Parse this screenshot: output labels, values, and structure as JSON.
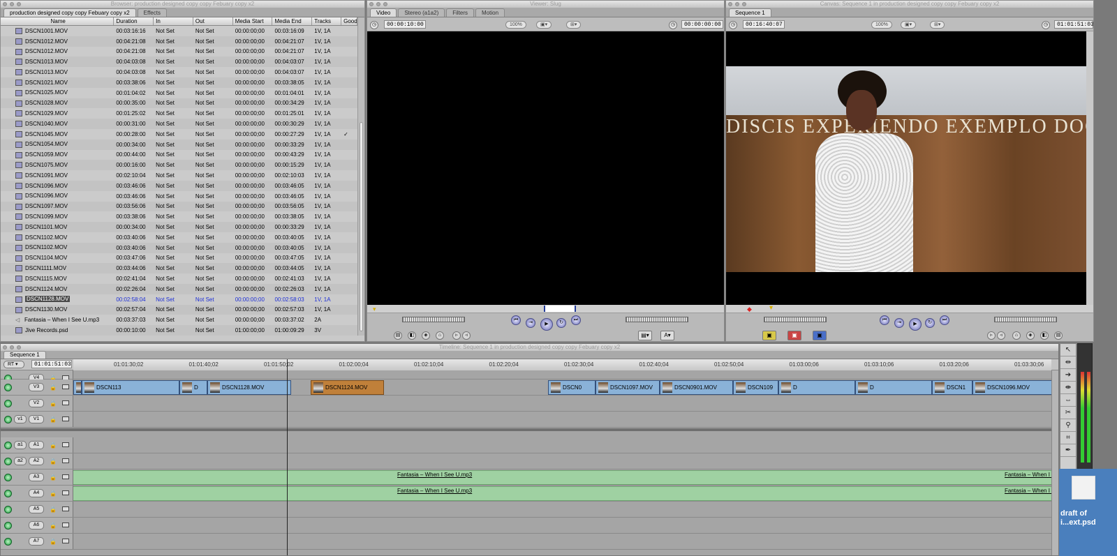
{
  "browser": {
    "title": "Browser: production designed copy copy Febuary copy x2",
    "tabs": [
      "production designed copy copy Febuary copy x2",
      "Effects"
    ],
    "columns": [
      "Name",
      "Duration",
      "In",
      "Out",
      "Media Start",
      "Media End",
      "Tracks",
      "Good"
    ],
    "rows": [
      {
        "name": "DSCN1001.MOV",
        "dur": "00:03:16:16",
        "in": "Not Set",
        "out": "Not Set",
        "ms": "00:00:00;00",
        "me": "00:03:16:09",
        "tr": "1V, 1A",
        "good": ""
      },
      {
        "name": "DSCN1012.MOV",
        "dur": "00:04:21:08",
        "in": "Not Set",
        "out": "Not Set",
        "ms": "00:00:00;00",
        "me": "00:04:21:07",
        "tr": "1V, 1A",
        "good": ""
      },
      {
        "name": "DSCN1012.MOV",
        "dur": "00:04:21:08",
        "in": "Not Set",
        "out": "Not Set",
        "ms": "00:00:00;00",
        "me": "00:04:21:07",
        "tr": "1V, 1A",
        "good": ""
      },
      {
        "name": "DSCN1013.MOV",
        "dur": "00:04:03:08",
        "in": "Not Set",
        "out": "Not Set",
        "ms": "00:00:00;00",
        "me": "00:04:03:07",
        "tr": "1V, 1A",
        "good": ""
      },
      {
        "name": "DSCN1013.MOV",
        "dur": "00:04:03:08",
        "in": "Not Set",
        "out": "Not Set",
        "ms": "00:00:00;00",
        "me": "00:04:03:07",
        "tr": "1V, 1A",
        "good": ""
      },
      {
        "name": "DSCN1021.MOV",
        "dur": "00:03:38:06",
        "in": "Not Set",
        "out": "Not Set",
        "ms": "00:00:00;00",
        "me": "00:03:38:05",
        "tr": "1V, 1A",
        "good": ""
      },
      {
        "name": "DSCN1025.MOV",
        "dur": "00:01:04:02",
        "in": "Not Set",
        "out": "Not Set",
        "ms": "00:00:00;00",
        "me": "00:01:04:01",
        "tr": "1V, 1A",
        "good": ""
      },
      {
        "name": "DSCN1028.MOV",
        "dur": "00:00:35:00",
        "in": "Not Set",
        "out": "Not Set",
        "ms": "00:00:00;00",
        "me": "00:00:34:29",
        "tr": "1V, 1A",
        "good": ""
      },
      {
        "name": "DSCN1029.MOV",
        "dur": "00:01:25:02",
        "in": "Not Set",
        "out": "Not Set",
        "ms": "00:00:00;00",
        "me": "00:01:25:01",
        "tr": "1V, 1A",
        "good": ""
      },
      {
        "name": "DSCN1040.MOV",
        "dur": "00:00:31:00",
        "in": "Not Set",
        "out": "Not Set",
        "ms": "00:00:00;00",
        "me": "00:00:30:29",
        "tr": "1V, 1A",
        "good": ""
      },
      {
        "name": "DSCN1045.MOV",
        "dur": "00:00:28:00",
        "in": "Not Set",
        "out": "Not Set",
        "ms": "00:00:00;00",
        "me": "00:00:27:29",
        "tr": "1V, 1A",
        "good": "✓"
      },
      {
        "name": "DSCN1054.MOV",
        "dur": "00:00:34:00",
        "in": "Not Set",
        "out": "Not Set",
        "ms": "00:00:00;00",
        "me": "00:00:33:29",
        "tr": "1V, 1A",
        "good": ""
      },
      {
        "name": "DSCN1059.MOV",
        "dur": "00:00:44:00",
        "in": "Not Set",
        "out": "Not Set",
        "ms": "00:00:00;00",
        "me": "00:00:43:29",
        "tr": "1V, 1A",
        "good": ""
      },
      {
        "name": "DSCN1075.MOV",
        "dur": "00:00:16:00",
        "in": "Not Set",
        "out": "Not Set",
        "ms": "00:00:00;00",
        "me": "00:00:15:29",
        "tr": "1V, 1A",
        "good": ""
      },
      {
        "name": "DSCN1091.MOV",
        "dur": "00:02:10:04",
        "in": "Not Set",
        "out": "Not Set",
        "ms": "00:00:00;00",
        "me": "00:02:10:03",
        "tr": "1V, 1A",
        "good": ""
      },
      {
        "name": "DSCN1096.MOV",
        "dur": "00:03:46:06",
        "in": "Not Set",
        "out": "Not Set",
        "ms": "00:00:00;00",
        "me": "00:03:46:05",
        "tr": "1V, 1A",
        "good": ""
      },
      {
        "name": "DSCN1096.MOV",
        "dur": "00:03:46:06",
        "in": "Not Set",
        "out": "Not Set",
        "ms": "00:00:00;00",
        "me": "00:03:46:05",
        "tr": "1V, 1A",
        "good": ""
      },
      {
        "name": "DSCN1097.MOV",
        "dur": "00:03:56:06",
        "in": "Not Set",
        "out": "Not Set",
        "ms": "00:00:00;00",
        "me": "00:03:56:05",
        "tr": "1V, 1A",
        "good": ""
      },
      {
        "name": "DSCN1099.MOV",
        "dur": "00:03:38:06",
        "in": "Not Set",
        "out": "Not Set",
        "ms": "00:00:00;00",
        "me": "00:03:38:05",
        "tr": "1V, 1A",
        "good": ""
      },
      {
        "name": "DSCN1101.MOV",
        "dur": "00:00:34:00",
        "in": "Not Set",
        "out": "Not Set",
        "ms": "00:00:00;00",
        "me": "00:00:33:29",
        "tr": "1V, 1A",
        "good": ""
      },
      {
        "name": "DSCN1102.MOV",
        "dur": "00:03:40:06",
        "in": "Not Set",
        "out": "Not Set",
        "ms": "00:00:00;00",
        "me": "00:03:40:05",
        "tr": "1V, 1A",
        "good": ""
      },
      {
        "name": "DSCN1102.MOV",
        "dur": "00:03:40:06",
        "in": "Not Set",
        "out": "Not Set",
        "ms": "00:00:00;00",
        "me": "00:03:40:05",
        "tr": "1V, 1A",
        "good": ""
      },
      {
        "name": "DSCN1104.MOV",
        "dur": "00:03:47:06",
        "in": "Not Set",
        "out": "Not Set",
        "ms": "00:00:00;00",
        "me": "00:03:47:05",
        "tr": "1V, 1A",
        "good": ""
      },
      {
        "name": "DSCN1111.MOV",
        "dur": "00:03:44:06",
        "in": "Not Set",
        "out": "Not Set",
        "ms": "00:00:00;00",
        "me": "00:03:44:05",
        "tr": "1V, 1A",
        "good": ""
      },
      {
        "name": "DSCN1115.MOV",
        "dur": "00:02:41:04",
        "in": "Not Set",
        "out": "Not Set",
        "ms": "00:00:00;00",
        "me": "00:02:41:03",
        "tr": "1V, 1A",
        "good": ""
      },
      {
        "name": "DSCN1124.MOV",
        "dur": "00:02:26:04",
        "in": "Not Set",
        "out": "Not Set",
        "ms": "00:00:00;00",
        "me": "00:02:26:03",
        "tr": "1V, 1A",
        "good": ""
      },
      {
        "name": "DSCN1128.MOV",
        "dur": "00:02:58:04",
        "in": "Not Set",
        "out": "Not Set",
        "ms": "00:00:00;00",
        "me": "00:02:58:03",
        "tr": "1V, 1A",
        "good": "",
        "selected": true
      },
      {
        "name": "DSCN1130.MOV",
        "dur": "00:02:57:04",
        "in": "Not Set",
        "out": "Not Set",
        "ms": "00:00:00;00",
        "me": "00:02:57:03",
        "tr": "1V, 1A",
        "good": ""
      },
      {
        "name": "Fantasia – When I See U.mp3",
        "dur": "00:03:37:03",
        "in": "Not Set",
        "out": "Not Set",
        "ms": "00:00:00;00",
        "me": "00:03:37:02",
        "tr": "2A",
        "good": "",
        "audio": true
      },
      {
        "name": "Jive Records.psd",
        "dur": "00:00:10:00",
        "in": "Not Set",
        "out": "Not Set",
        "ms": "01:00:00;00",
        "me": "01:00:09:29",
        "tr": "3V",
        "good": ""
      }
    ]
  },
  "viewer": {
    "title": "Viewer: Slug",
    "tabs": [
      "Video",
      "Stereo (a1a2)",
      "Filters",
      "Motion"
    ],
    "duration_tc": "00:00:10:00",
    "zoom": "100%",
    "current_tc": "00:00:00:00"
  },
  "canvas": {
    "title": "Canvas: Sequence 1 in production designed copy copy Febuary copy x2",
    "tabs": [
      "Sequence 1"
    ],
    "duration_tc": "00:16:40:07",
    "zoom": "100%",
    "current_tc": "01:01:51:03",
    "frame_inscription": "DISCIS EXPERIENDO  EXEMPLO DOCES"
  },
  "timeline": {
    "title": "Timeline: Sequence 1 in production designed copy copy Febuary copy x2",
    "tab": "Sequence 1",
    "rt_label": "RT",
    "current_tc": "01:01:51:03",
    "ruler": [
      "01:01:30;02",
      "01:01:40;02",
      "01:01:50;02",
      "01:02:00;04",
      "01:02:10;04",
      "01:02:20;04",
      "01:02:30;04",
      "01:02:40;04",
      "01:02:50;04",
      "01:03:00;06",
      "01:03:10;06",
      "01:03:20;06",
      "01:03:30;06"
    ],
    "video_tracks": [
      {
        "name": "V4",
        "src": ""
      },
      {
        "name": "V3",
        "src": ""
      },
      {
        "name": "V2",
        "src": ""
      },
      {
        "name": "V1",
        "src": "v1"
      }
    ],
    "audio_tracks": [
      {
        "name": "A1",
        "src": "a1"
      },
      {
        "name": "A2",
        "src": "a2"
      },
      {
        "name": "A3",
        "src": ""
      },
      {
        "name": "A4",
        "src": ""
      },
      {
        "name": "A5",
        "src": ""
      },
      {
        "name": "A6",
        "src": ""
      },
      {
        "name": "A7",
        "src": ""
      }
    ],
    "v3_clips": [
      "D",
      "DSCN113",
      "D",
      "DSCN1128.MOV",
      "DSCN1124.MOV",
      "DSCN0",
      "DSCN1097.MOV",
      "DSCN0901.MOV",
      "DSCN109",
      "D",
      "D",
      "DSCN1",
      "DSCN1096.MOV"
    ],
    "audio_clip_label": "Fantasia – When I See U.mp3",
    "audio_clip_label_short": "Fantasia – When I S"
  },
  "desktop": {
    "file_label_line1": "draft of",
    "file_label_line2": "i...ext.psd"
  }
}
